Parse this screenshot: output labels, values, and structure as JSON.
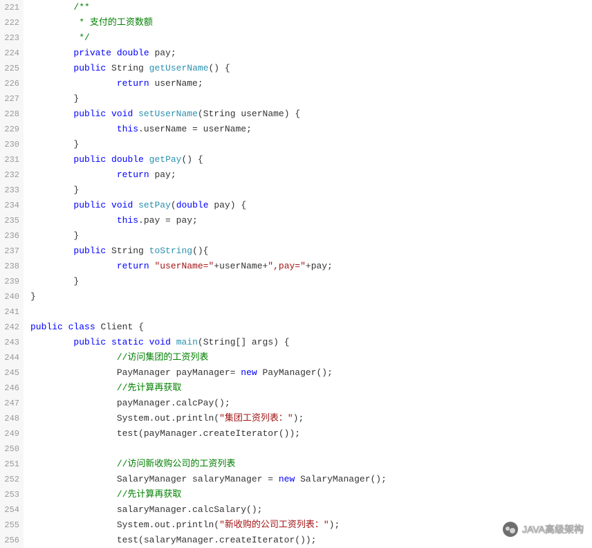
{
  "startLine": 221,
  "lines": [
    [
      {
        "indent": 2,
        "cls": "com",
        "text": "/**"
      }
    ],
    [
      {
        "indent": 2,
        "cls": "com",
        "text": " * 支付的工资数额"
      }
    ],
    [
      {
        "indent": 2,
        "cls": "com",
        "text": " */"
      }
    ],
    [
      {
        "indent": 2,
        "cls": "kw",
        "text": "private"
      },
      {
        "cls": "txt",
        "text": " "
      },
      {
        "cls": "kw",
        "text": "double"
      },
      {
        "cls": "txt",
        "text": " pay;"
      }
    ],
    [
      {
        "indent": 2,
        "cls": "kw",
        "text": "public"
      },
      {
        "cls": "txt",
        "text": " String "
      },
      {
        "cls": "mth",
        "text": "getUserName"
      },
      {
        "cls": "txt",
        "text": "() {"
      }
    ],
    [
      {
        "indent": 4,
        "cls": "kw",
        "text": "return"
      },
      {
        "cls": "txt",
        "text": " userName;"
      }
    ],
    [
      {
        "indent": 2,
        "cls": "txt",
        "text": "}"
      }
    ],
    [
      {
        "indent": 2,
        "cls": "kw",
        "text": "public"
      },
      {
        "cls": "txt",
        "text": " "
      },
      {
        "cls": "kw",
        "text": "void"
      },
      {
        "cls": "txt",
        "text": " "
      },
      {
        "cls": "mth",
        "text": "setUserName"
      },
      {
        "cls": "txt",
        "text": "(String userName) {"
      }
    ],
    [
      {
        "indent": 4,
        "cls": "kw",
        "text": "this"
      },
      {
        "cls": "txt",
        "text": ".userName = userName;"
      }
    ],
    [
      {
        "indent": 2,
        "cls": "txt",
        "text": "}"
      }
    ],
    [
      {
        "indent": 2,
        "cls": "kw",
        "text": "public"
      },
      {
        "cls": "txt",
        "text": " "
      },
      {
        "cls": "kw",
        "text": "double"
      },
      {
        "cls": "txt",
        "text": " "
      },
      {
        "cls": "mth",
        "text": "getPay"
      },
      {
        "cls": "txt",
        "text": "() {"
      }
    ],
    [
      {
        "indent": 4,
        "cls": "kw",
        "text": "return"
      },
      {
        "cls": "txt",
        "text": " pay;"
      }
    ],
    [
      {
        "indent": 2,
        "cls": "txt",
        "text": "}"
      }
    ],
    [
      {
        "indent": 2,
        "cls": "kw",
        "text": "public"
      },
      {
        "cls": "txt",
        "text": " "
      },
      {
        "cls": "kw",
        "text": "void"
      },
      {
        "cls": "txt",
        "text": " "
      },
      {
        "cls": "mth",
        "text": "setPay"
      },
      {
        "cls": "txt",
        "text": "("
      },
      {
        "cls": "kw",
        "text": "double"
      },
      {
        "cls": "txt",
        "text": " pay) {"
      }
    ],
    [
      {
        "indent": 4,
        "cls": "kw",
        "text": "this"
      },
      {
        "cls": "txt",
        "text": ".pay = pay;"
      }
    ],
    [
      {
        "indent": 2,
        "cls": "txt",
        "text": "}"
      }
    ],
    [
      {
        "indent": 2,
        "cls": "kw",
        "text": "public"
      },
      {
        "cls": "txt",
        "text": " String "
      },
      {
        "cls": "mth",
        "text": "toString"
      },
      {
        "cls": "txt",
        "text": "(){"
      }
    ],
    [
      {
        "indent": 4,
        "cls": "kw",
        "text": "return"
      },
      {
        "cls": "txt",
        "text": " "
      },
      {
        "cls": "str",
        "text": "\"userName=\""
      },
      {
        "cls": "txt",
        "text": "+userName+"
      },
      {
        "cls": "str",
        "text": "\",pay=\""
      },
      {
        "cls": "txt",
        "text": "+pay;"
      }
    ],
    [
      {
        "indent": 2,
        "cls": "txt",
        "text": "}"
      }
    ],
    [
      {
        "indent": 0,
        "cls": "txt",
        "text": "}"
      }
    ],
    [
      {
        "indent": 0,
        "cls": "txt",
        "text": ""
      }
    ],
    [
      {
        "indent": 0,
        "cls": "kw",
        "text": "public"
      },
      {
        "cls": "txt",
        "text": " "
      },
      {
        "cls": "kw",
        "text": "class"
      },
      {
        "cls": "txt",
        "text": " "
      },
      {
        "cls": "cls",
        "text": "Client"
      },
      {
        "cls": "txt",
        "text": " {"
      }
    ],
    [
      {
        "indent": 2,
        "cls": "kw",
        "text": "public"
      },
      {
        "cls": "txt",
        "text": " "
      },
      {
        "cls": "kw",
        "text": "static"
      },
      {
        "cls": "txt",
        "text": " "
      },
      {
        "cls": "kw",
        "text": "void"
      },
      {
        "cls": "txt",
        "text": " "
      },
      {
        "cls": "mth",
        "text": "main"
      },
      {
        "cls": "txt",
        "text": "(String[] args) {"
      }
    ],
    [
      {
        "indent": 4,
        "cls": "com",
        "text": "//访问集团的工资列表"
      }
    ],
    [
      {
        "indent": 4,
        "cls": "txt",
        "text": "PayManager payManager= "
      },
      {
        "cls": "kw",
        "text": "new"
      },
      {
        "cls": "txt",
        "text": " PayManager();"
      }
    ],
    [
      {
        "indent": 4,
        "cls": "com",
        "text": "//先计算再获取"
      }
    ],
    [
      {
        "indent": 4,
        "cls": "txt",
        "text": "payManager.calcPay();"
      }
    ],
    [
      {
        "indent": 4,
        "cls": "txt",
        "text": "System.out.println("
      },
      {
        "cls": "str",
        "text": "\"集团工资列表：\""
      },
      {
        "cls": "txt",
        "text": ");"
      }
    ],
    [
      {
        "indent": 4,
        "cls": "txt",
        "text": "test(payManager.createIterator());"
      }
    ],
    [
      {
        "indent": 0,
        "cls": "txt",
        "text": ""
      }
    ],
    [
      {
        "indent": 4,
        "cls": "com",
        "text": "//访问新收购公司的工资列表"
      }
    ],
    [
      {
        "indent": 4,
        "cls": "txt",
        "text": "SalaryManager salaryManager = "
      },
      {
        "cls": "kw",
        "text": "new"
      },
      {
        "cls": "txt",
        "text": " SalaryManager();"
      }
    ],
    [
      {
        "indent": 4,
        "cls": "com",
        "text": "//先计算再获取"
      }
    ],
    [
      {
        "indent": 4,
        "cls": "txt",
        "text": "salaryManager.calcSalary();"
      }
    ],
    [
      {
        "indent": 4,
        "cls": "txt",
        "text": "System.out.println("
      },
      {
        "cls": "str",
        "text": "\"新收购的公司工资列表：\""
      },
      {
        "cls": "txt",
        "text": ");"
      }
    ],
    [
      {
        "indent": 4,
        "cls": "txt",
        "text": "test(salaryManager.createIterator());"
      }
    ]
  ],
  "watermark": {
    "text": "JAVA高级架构"
  }
}
